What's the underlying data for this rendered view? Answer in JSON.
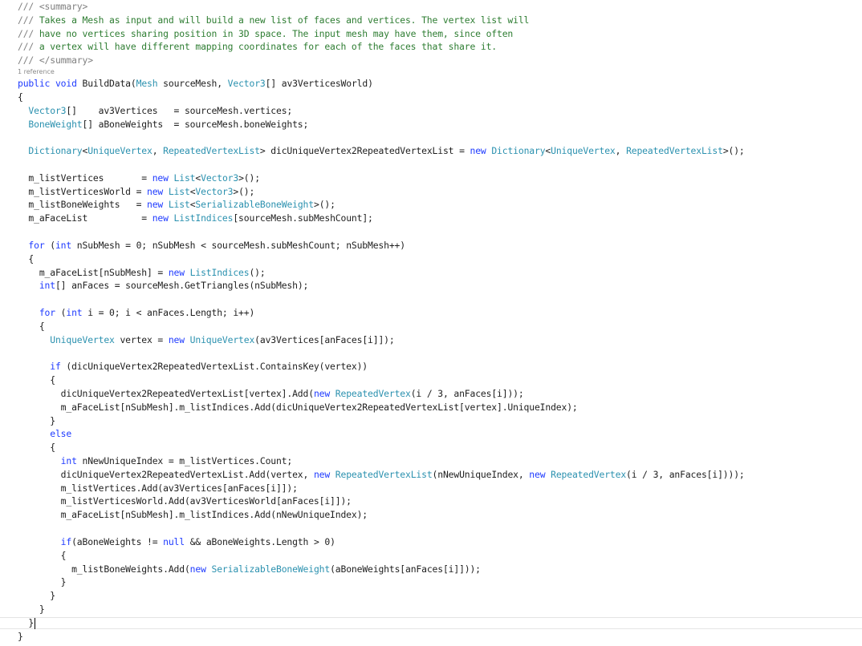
{
  "editor": {
    "codelens_label": "1 reference",
    "lines": [
      [
        [
          "xml",
          "/// "
        ],
        [
          "xml",
          "<summary>"
        ]
      ],
      [
        [
          "xml",
          "/// "
        ],
        [
          "cm",
          "Takes a Mesh as input and will build a new list of faces and vertices. The vertex list will"
        ]
      ],
      [
        [
          "xml",
          "/// "
        ],
        [
          "cm",
          "have no vertices sharing position in 3D space. The input mesh may have them, since often"
        ]
      ],
      [
        [
          "xml",
          "/// "
        ],
        [
          "cm",
          "a vertex will have different mapping coordinates for each of the faces that share it."
        ]
      ],
      [
        [
          "xml",
          "/// "
        ],
        [
          "xml",
          "</summary>"
        ]
      ],
      [
        [
          "kw",
          "public"
        ],
        [
          "tx",
          " "
        ],
        [
          "kw",
          "void"
        ],
        [
          "tx",
          " BuildData("
        ],
        [
          "ty",
          "Mesh"
        ],
        [
          "tx",
          " sourceMesh, "
        ],
        [
          "ty",
          "Vector3"
        ],
        [
          "tx",
          "[] av3VerticesWorld)"
        ]
      ],
      [
        [
          "tx",
          "{"
        ]
      ],
      [
        [
          "tx",
          "  "
        ],
        [
          "ty",
          "Vector3"
        ],
        [
          "tx",
          "[]    av3Vertices   = sourceMesh.vertices;"
        ]
      ],
      [
        [
          "tx",
          "  "
        ],
        [
          "ty",
          "BoneWeight"
        ],
        [
          "tx",
          "[] aBoneWeights  = sourceMesh.boneWeights;"
        ]
      ],
      [],
      [
        [
          "tx",
          "  "
        ],
        [
          "ty",
          "Dictionary"
        ],
        [
          "tx",
          "<"
        ],
        [
          "ty",
          "UniqueVertex"
        ],
        [
          "tx",
          ", "
        ],
        [
          "ty",
          "RepeatedVertexList"
        ],
        [
          "tx",
          "> dicUniqueVertex2RepeatedVertexList = "
        ],
        [
          "kw",
          "new"
        ],
        [
          "tx",
          " "
        ],
        [
          "ty",
          "Dictionary"
        ],
        [
          "tx",
          "<"
        ],
        [
          "ty",
          "UniqueVertex"
        ],
        [
          "tx",
          ", "
        ],
        [
          "ty",
          "RepeatedVertexList"
        ],
        [
          "tx",
          ">();"
        ]
      ],
      [],
      [
        [
          "tx",
          "  m_listVertices       = "
        ],
        [
          "kw",
          "new"
        ],
        [
          "tx",
          " "
        ],
        [
          "ty",
          "List"
        ],
        [
          "tx",
          "<"
        ],
        [
          "ty",
          "Vector3"
        ],
        [
          "tx",
          ">();"
        ]
      ],
      [
        [
          "tx",
          "  m_listVerticesWorld = "
        ],
        [
          "kw",
          "new"
        ],
        [
          "tx",
          " "
        ],
        [
          "ty",
          "List"
        ],
        [
          "tx",
          "<"
        ],
        [
          "ty",
          "Vector3"
        ],
        [
          "tx",
          ">();"
        ]
      ],
      [
        [
          "tx",
          "  m_listBoneWeights   = "
        ],
        [
          "kw",
          "new"
        ],
        [
          "tx",
          " "
        ],
        [
          "ty",
          "List"
        ],
        [
          "tx",
          "<"
        ],
        [
          "ty",
          "SerializableBoneWeight"
        ],
        [
          "tx",
          ">();"
        ]
      ],
      [
        [
          "tx",
          "  m_aFaceList          = "
        ],
        [
          "kw",
          "new"
        ],
        [
          "tx",
          " "
        ],
        [
          "ty",
          "ListIndices"
        ],
        [
          "tx",
          "[sourceMesh.subMeshCount];"
        ]
      ],
      [],
      [
        [
          "tx",
          "  "
        ],
        [
          "kw",
          "for"
        ],
        [
          "tx",
          " ("
        ],
        [
          "kw",
          "int"
        ],
        [
          "tx",
          " nSubMesh = 0; nSubMesh < sourceMesh.subMeshCount; nSubMesh++)"
        ]
      ],
      [
        [
          "tx",
          "  {"
        ]
      ],
      [
        [
          "tx",
          "    m_aFaceList[nSubMesh] = "
        ],
        [
          "kw",
          "new"
        ],
        [
          "tx",
          " "
        ],
        [
          "ty",
          "ListIndices"
        ],
        [
          "tx",
          "();"
        ]
      ],
      [
        [
          "tx",
          "    "
        ],
        [
          "kw",
          "int"
        ],
        [
          "tx",
          "[] anFaces = sourceMesh.GetTriangles(nSubMesh);"
        ]
      ],
      [],
      [
        [
          "tx",
          "    "
        ],
        [
          "kw",
          "for"
        ],
        [
          "tx",
          " ("
        ],
        [
          "kw",
          "int"
        ],
        [
          "tx",
          " i = 0; i < anFaces.Length; i++)"
        ]
      ],
      [
        [
          "tx",
          "    {"
        ]
      ],
      [
        [
          "tx",
          "      "
        ],
        [
          "ty",
          "UniqueVertex"
        ],
        [
          "tx",
          " vertex = "
        ],
        [
          "kw",
          "new"
        ],
        [
          "tx",
          " "
        ],
        [
          "ty",
          "UniqueVertex"
        ],
        [
          "tx",
          "(av3Vertices[anFaces[i]]);"
        ]
      ],
      [],
      [
        [
          "tx",
          "      "
        ],
        [
          "kw",
          "if"
        ],
        [
          "tx",
          " (dicUniqueVertex2RepeatedVertexList.ContainsKey(vertex))"
        ]
      ],
      [
        [
          "tx",
          "      {"
        ]
      ],
      [
        [
          "tx",
          "        dicUniqueVertex2RepeatedVertexList[vertex].Add("
        ],
        [
          "kw",
          "new"
        ],
        [
          "tx",
          " "
        ],
        [
          "ty",
          "RepeatedVertex"
        ],
        [
          "tx",
          "(i / 3, anFaces[i]));"
        ]
      ],
      [
        [
          "tx",
          "        m_aFaceList[nSubMesh].m_listIndices.Add(dicUniqueVertex2RepeatedVertexList[vertex].UniqueIndex);"
        ]
      ],
      [
        [
          "tx",
          "      }"
        ]
      ],
      [
        [
          "tx",
          "      "
        ],
        [
          "kw",
          "else"
        ]
      ],
      [
        [
          "tx",
          "      {"
        ]
      ],
      [
        [
          "tx",
          "        "
        ],
        [
          "kw",
          "int"
        ],
        [
          "tx",
          " nNewUniqueIndex = m_listVertices.Count;"
        ]
      ],
      [
        [
          "tx",
          "        dicUniqueVertex2RepeatedVertexList.Add(vertex, "
        ],
        [
          "kw",
          "new"
        ],
        [
          "tx",
          " "
        ],
        [
          "ty",
          "RepeatedVertexList"
        ],
        [
          "tx",
          "(nNewUniqueIndex, "
        ],
        [
          "kw",
          "new"
        ],
        [
          "tx",
          " "
        ],
        [
          "ty",
          "RepeatedVertex"
        ],
        [
          "tx",
          "(i / 3, anFaces[i])));"
        ]
      ],
      [
        [
          "tx",
          "        m_listVertices.Add(av3Vertices[anFaces[i]]);"
        ]
      ],
      [
        [
          "tx",
          "        m_listVerticesWorld.Add(av3VerticesWorld[anFaces[i]]);"
        ]
      ],
      [
        [
          "tx",
          "        m_aFaceList[nSubMesh].m_listIndices.Add(nNewUniqueIndex);"
        ]
      ],
      [],
      [
        [
          "tx",
          "        "
        ],
        [
          "kw",
          "if"
        ],
        [
          "tx",
          "(aBoneWeights != "
        ],
        [
          "kw",
          "null"
        ],
        [
          "tx",
          " && aBoneWeights.Length > 0)"
        ]
      ],
      [
        [
          "tx",
          "        {"
        ]
      ],
      [
        [
          "tx",
          "          m_listBoneWeights.Add("
        ],
        [
          "kw",
          "new"
        ],
        [
          "tx",
          " "
        ],
        [
          "ty",
          "SerializableBoneWeight"
        ],
        [
          "tx",
          "(aBoneWeights[anFaces[i]]));"
        ]
      ],
      [
        [
          "tx",
          "        }"
        ]
      ],
      [
        [
          "tx",
          "      }"
        ]
      ],
      [
        [
          "tx",
          "    }"
        ]
      ],
      [
        [
          "tx",
          "  }"
        ]
      ],
      [
        [
          "tx",
          "}"
        ]
      ]
    ]
  }
}
